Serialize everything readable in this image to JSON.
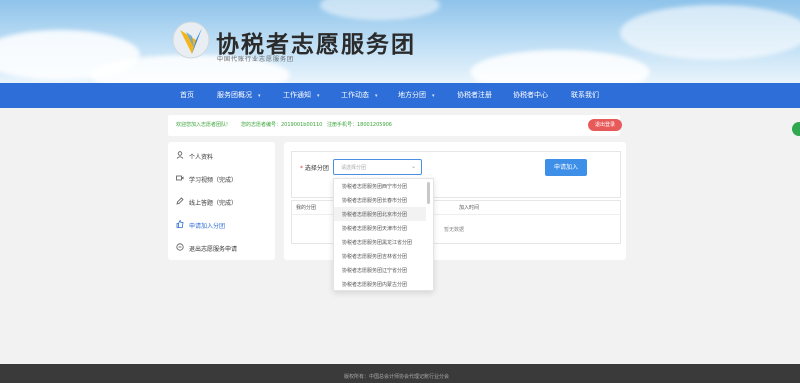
{
  "header": {
    "site_title": "协税者志愿服务团",
    "site_subtitle": "中国代账行业志愿服务团",
    "logo_icon": "tax-volunteer-logo-icon"
  },
  "nav": {
    "items": [
      {
        "label": "首页",
        "has_caret": false
      },
      {
        "label": "服务团概况",
        "has_caret": true
      },
      {
        "label": "工作通知",
        "has_caret": true
      },
      {
        "label": "工作动态",
        "has_caret": true
      },
      {
        "label": "地方分团",
        "has_caret": true
      },
      {
        "label": "协税者注册",
        "has_caret": false
      },
      {
        "label": "协税者中心",
        "has_caret": false
      },
      {
        "label": "联系我们",
        "has_caret": false
      }
    ],
    "caret": "▾",
    "color": "#2d6ed8"
  },
  "welcome": {
    "greeting": "欢迎您加入志愿者团队!",
    "volunteer_no": "您的志愿者编号：2019001b00110",
    "phone": "注册手机号：18001205906",
    "logout_label": "退出登录"
  },
  "sidebar": {
    "items": [
      {
        "label": "个人资料",
        "icon": "user-icon",
        "active": false
      },
      {
        "label": "学习视频（完成）",
        "icon": "video-icon",
        "active": false
      },
      {
        "label": "线上答题（完成）",
        "icon": "pen-icon",
        "active": false
      },
      {
        "label": "申请加入分团",
        "icon": "thumbs-up-icon",
        "active": true
      },
      {
        "label": "退出志愿服务申请",
        "icon": "exit-icon",
        "active": false
      }
    ]
  },
  "form": {
    "required_mark": "*",
    "select_label": "选择分团",
    "select_placeholder": "请选择分团",
    "apply_label": "申请加入"
  },
  "table": {
    "headers": [
      "我的分团",
      "加入时间"
    ],
    "empty_text": "暂无数据"
  },
  "dropdown": {
    "options": [
      "协税者志愿服务团西宁市分团",
      "协税者志愿服务团长春市分团",
      "协税者志愿服务团北京市分团",
      "协税者志愿服务团天津市分团",
      "协税者志愿服务团黑龙江省分团",
      "协税者志愿服务团吉林省分团",
      "协税者志愿服务团辽宁省分团",
      "协税者志愿服务团内蒙古分团"
    ],
    "hovered_index": 2
  },
  "footer": {
    "copyright": "版权所有：中国总会计师协会代理记账行业分会"
  }
}
